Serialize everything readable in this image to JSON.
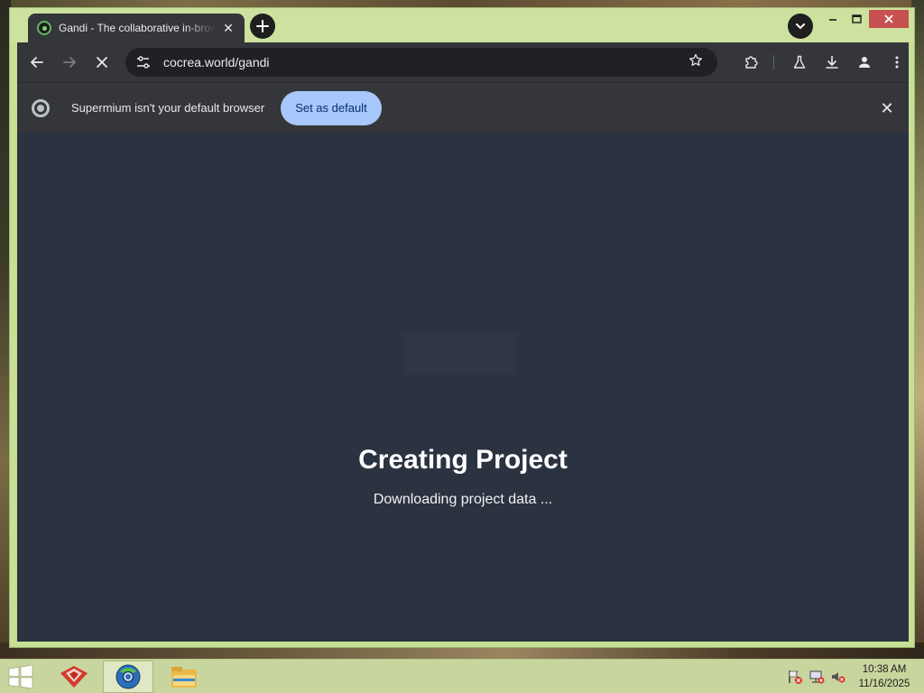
{
  "browser": {
    "tab": {
      "title": "Gandi - The collaborative in-browser",
      "close_icon": "close-icon"
    },
    "new_tab_icon": "plus-icon",
    "tab_search_icon": "chevron-down-icon",
    "window_controls": [
      "minimize-icon",
      "maximize-icon",
      "close-icon"
    ],
    "toolbar": {
      "back_icon": "arrow-left-icon",
      "forward_icon": "arrow-right-icon",
      "stop_icon": "close-icon",
      "site_info_icon": "tune-icon",
      "url": "cocrea.world/gandi",
      "bookmark_icon": "star-icon",
      "extensions_icon": "puzzle-icon",
      "labs_icon": "flask-icon",
      "downloads_icon": "download-icon",
      "profile_icon": "person-icon",
      "menu_icon": "more-vert-icon"
    },
    "infobar": {
      "logo_icon": "chromium-logo-icon",
      "message": "Supermium isn't your default browser",
      "button_label": "Set as default",
      "close_icon": "close-icon"
    }
  },
  "page": {
    "title": "Creating Project",
    "status": "Downloading project data ..."
  },
  "taskbar": {
    "start_icon": "windows-logo-icon",
    "apps": [
      {
        "name": "app-red-icon",
        "active": false
      },
      {
        "name": "browser-icon",
        "active": true
      },
      {
        "name": "file-explorer-icon",
        "active": false
      }
    ],
    "tray": [
      "flag-icon",
      "network-icon",
      "volume-muted-icon"
    ],
    "time": "10:38 AM",
    "date": "11/16/2025"
  },
  "colors": {
    "tabstrip": "#cde29e",
    "toolbar": "#35363a",
    "content_bg": "#2b3240",
    "accent_button": "#a8c7fa",
    "close_red": "#c75050",
    "taskbar": "#c9d59e"
  }
}
